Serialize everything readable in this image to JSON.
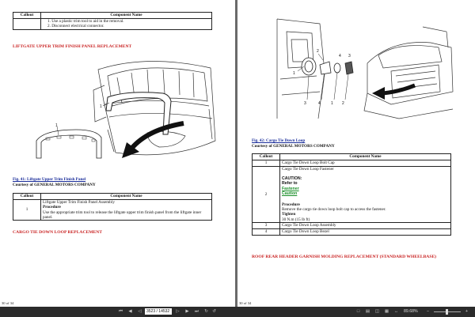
{
  "left_page": {
    "table_top": {
      "headers": [
        "Callout",
        "Component Name"
      ],
      "rows": [
        {
          "callout": "",
          "lines": [
            "1. Use a plastic trim tool to aid in the removal.",
            "2. Disconnect electrical connector."
          ]
        }
      ]
    },
    "section_heading": "LIFTGATE UPPER TRIM FINISH PANEL REPLACEMENT",
    "illustration_callouts": [
      "1",
      "1"
    ],
    "figure_caption": "Fig. 41: Liftgate Upper Trim Finish Panel",
    "courtesy": "Courtesy of GENERAL MOTORS COMPANY",
    "table_bottom": {
      "headers": [
        "Callout",
        "Component Name"
      ],
      "rows": [
        {
          "callout": "1",
          "name": "Liftgate Upper Trim Finish Panel Assembly",
          "procedure_label": "Procedure",
          "procedure_text": "Use the appropriate trim tool to release the liftgate upper trim finish panel from the liftgate inner panel."
        }
      ]
    },
    "next_heading": "CARGO TIE DOWN LOOP REPLACEMENT",
    "page_number": "30 of 34"
  },
  "right_page": {
    "illustration_callouts": [
      "1",
      "2",
      "3",
      "4",
      "1",
      "2",
      "3",
      "4"
    ],
    "figure_caption": "Fig. 42: Cargo Tie Down Loop",
    "courtesy": "Courtesy of GENERAL MOTORS COMPANY",
    "table": {
      "headers": [
        "Callout",
        "Component Name"
      ],
      "row1": {
        "callout": "1",
        "name": "Cargo Tie Down Loop Bolt Cap"
      },
      "row2": {
        "callout": "2",
        "name": "Cargo Tie Down Loop Fastener",
        "caution_label": "CAUTION:",
        "refer_to": "Refer to",
        "link1": "Fastener",
        "link2": "Caution",
        "procedure_label": "Procedure",
        "procedure_text": "Remove the cargo tie down loop bolt cap to access the fastener.",
        "tighten_label": "Tighten",
        "tighten_value": "30 N.m (15 lb ft)"
      },
      "row3": {
        "callout": "3",
        "name": "Cargo Tie Down Loop Assembly"
      },
      "row4": {
        "callout": "4",
        "name": "Cargo Tie Down Loop Bezel"
      }
    },
    "next_heading": "ROOF REAR HEADER GARNISH MOLDING REPLACEMENT (STANDARD WHEELBASE)",
    "page_number": "30 of 34"
  },
  "statusbar": {
    "page_value": "3523 / 14532",
    "zoom": "89.68%",
    "icons": [
      "first-page-icon",
      "prev-page-icon",
      "next-page-icon",
      "last-page-icon",
      "back-icon",
      "forward-icon",
      "single-page-icon",
      "continuous-icon",
      "facing-icon",
      "zoom-out-icon",
      "zoom-in-icon"
    ]
  }
}
